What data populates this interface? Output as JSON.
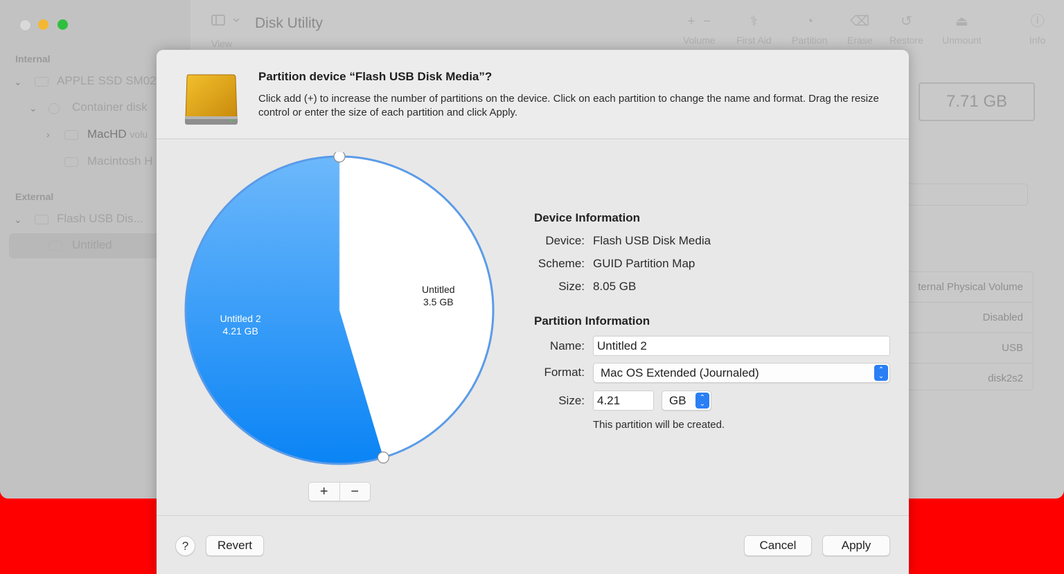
{
  "window": {
    "title": "Disk Utility",
    "view_label": "View"
  },
  "toolbar": {
    "volume": "Volume",
    "first_aid": "First Aid",
    "partition": "Partition",
    "erase": "Erase",
    "restore": "Restore",
    "unmount": "Unmount",
    "info": "Info"
  },
  "sidebar": {
    "internal_header": "Internal",
    "external_header": "External",
    "items": [
      {
        "label": "APPLE SSD SM02"
      },
      {
        "label": "Container disk"
      },
      {
        "label": "MacHD",
        "suffix": "volu"
      },
      {
        "label": "Macintosh H"
      },
      {
        "label": "Flash USB Dis..."
      },
      {
        "label": "Untitled"
      }
    ]
  },
  "background_panel": {
    "capacity": "7.71 GB",
    "rows": [
      "ternal Physical Volume",
      "Disabled",
      "USB",
      "disk2s2"
    ]
  },
  "sheet": {
    "title": "Partition device “Flash USB Disk Media”?",
    "description": "Click add (+) to increase the number of partitions on the device. Click on each partition to change the name and format. Drag the resize control or enter the size of each partition and click Apply.",
    "pie": {
      "partitions": [
        {
          "name": "Untitled 2",
          "size": "4.21 GB",
          "gb": 4.21,
          "color": "#1a8df8"
        },
        {
          "name": "Untitled",
          "size": "3.5 GB",
          "gb": 3.5,
          "color": "#ffffff"
        }
      ],
      "add_label": "+",
      "remove_label": "−"
    },
    "device_info": {
      "heading": "Device Information",
      "device_label": "Device:",
      "device_value": "Flash USB Disk Media",
      "scheme_label": "Scheme:",
      "scheme_value": "GUID Partition Map",
      "size_label": "Size:",
      "size_value": "8.05 GB"
    },
    "partition_info": {
      "heading": "Partition Information",
      "name_label": "Name:",
      "name_value": "Untitled 2",
      "format_label": "Format:",
      "format_value": "Mac OS Extended (Journaled)",
      "size_label": "Size:",
      "size_value": "4.21",
      "size_unit": "GB",
      "note": "This partition will be created."
    },
    "buttons": {
      "help": "?",
      "revert": "Revert",
      "cancel": "Cancel",
      "apply": "Apply"
    }
  },
  "colors": {
    "accent": "#1a8df8",
    "close_red_bar": "#ff0000",
    "minimize": "#f4b733",
    "maximize": "#2fc03f"
  }
}
